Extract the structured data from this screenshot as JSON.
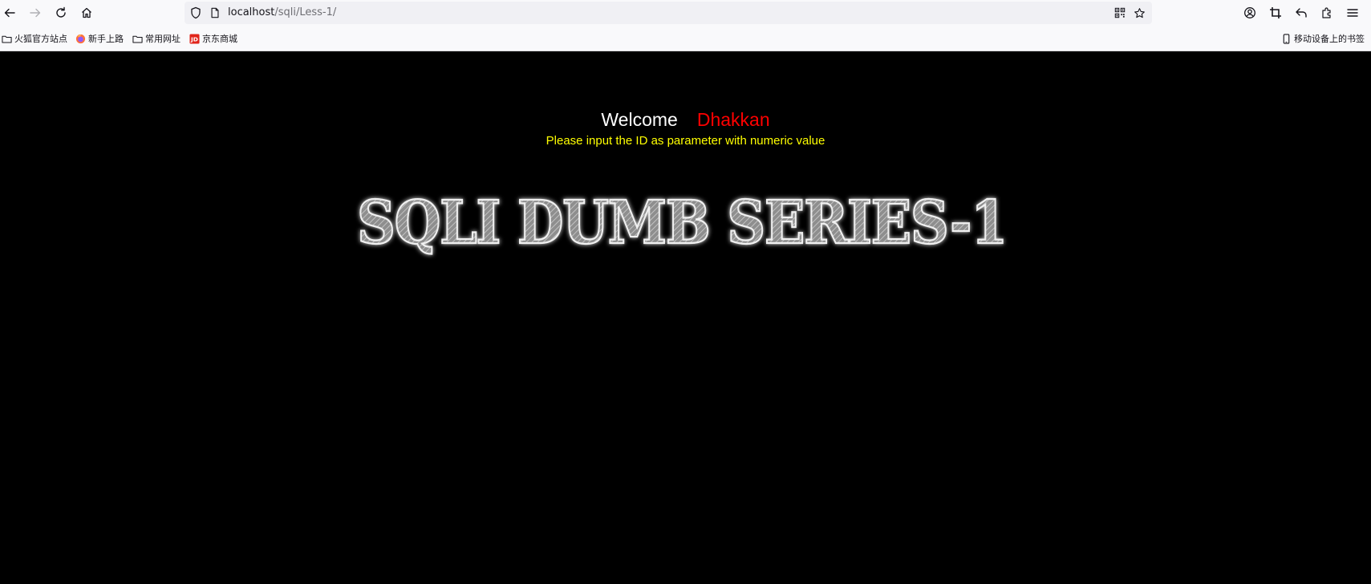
{
  "browser": {
    "url_host": "localhost",
    "url_path": "/sqli/Less-1/",
    "bookmarks": [
      {
        "label": "火狐官方站点",
        "icon": "folder-icon"
      },
      {
        "label": "新手上路",
        "icon": "firefox-icon"
      },
      {
        "label": "常用网址",
        "icon": "folder-icon"
      },
      {
        "label": "京东商城",
        "icon": "jd-icon"
      }
    ],
    "mobile_bookmarks": "移动设备上的书签"
  },
  "page": {
    "welcome": "Welcome",
    "username": "Dhakkan",
    "instruction": "Please input the ID as parameter with numeric value",
    "banner_text": "SQLI DUMB SERIES-1"
  },
  "colors": {
    "background": "#000000",
    "welcome": "#ffffff",
    "username": "#ff0000",
    "instruction": "#ffff00"
  }
}
